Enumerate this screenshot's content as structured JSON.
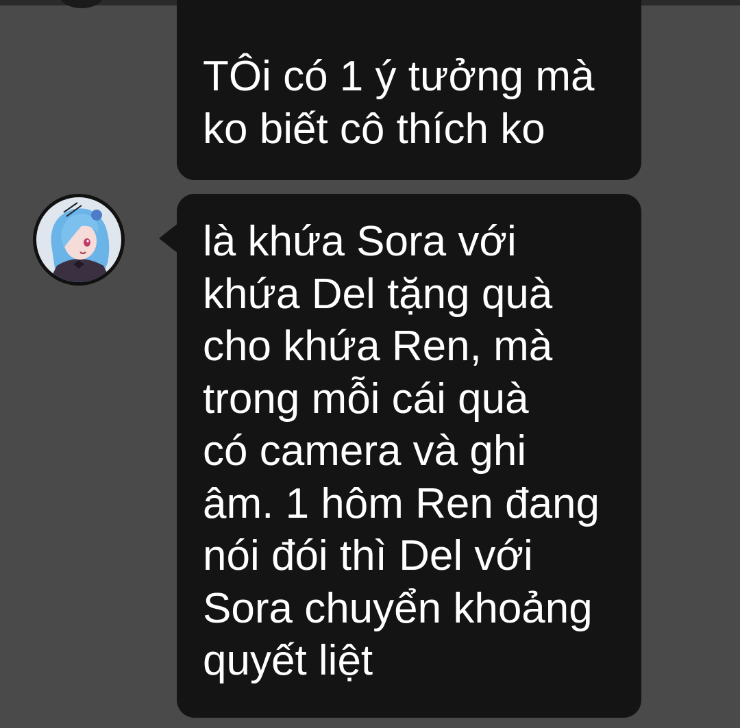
{
  "chat": {
    "messages": [
      {
        "lines": [
          "TÔi có 1 ý tưởng mà",
          "ko biết cô thích ko"
        ]
      },
      {
        "lines": [
          "là khứa Sora với",
          "khứa Del tặng quà",
          "cho khứa Ren, mà",
          "trong mỗi cái quà",
          "có camera và ghi",
          "âm. 1 hôm Ren đang",
          "nói đói thì Del với",
          "Sora chuyển khoảng",
          "quyết liệt"
        ]
      }
    ]
  },
  "colors": {
    "background": "#4a4a4a",
    "bubble": "#141414",
    "text": "#ffffff",
    "avatar_hair": "#6ab4e8"
  },
  "icons": {
    "sender_avatar": "anime-avatar-blue-hair-icon"
  }
}
